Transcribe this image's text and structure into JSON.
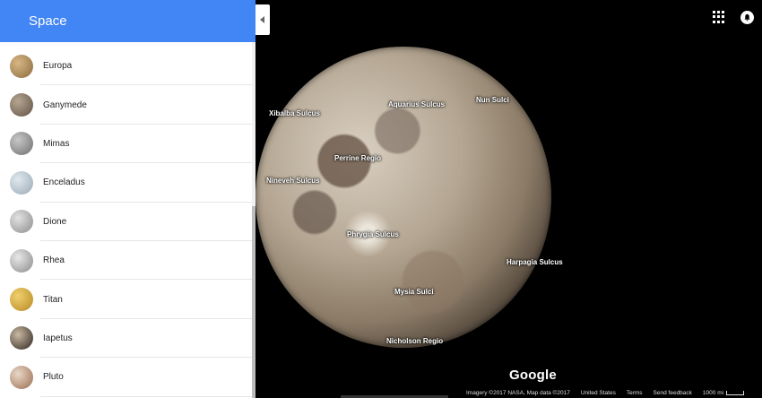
{
  "sidebar": {
    "title": "Space",
    "items": [
      {
        "label": "Europa",
        "color_a": "#d8b684",
        "color_b": "#8a6a3f"
      },
      {
        "label": "Ganymede",
        "color_a": "#b6a592",
        "color_b": "#5f5143"
      },
      {
        "label": "Mimas",
        "color_a": "#c7c7c7",
        "color_b": "#6e6e6e"
      },
      {
        "label": "Enceladus",
        "color_a": "#dfe8ee",
        "color_b": "#9aa9b5"
      },
      {
        "label": "Dione",
        "color_a": "#e2e2e2",
        "color_b": "#8c8c8c"
      },
      {
        "label": "Rhea",
        "color_a": "#e8e8e8",
        "color_b": "#8a8a8a"
      },
      {
        "label": "Titan",
        "color_a": "#f0cf6e",
        "color_b": "#b78a24"
      },
      {
        "label": "Iapetus",
        "color_a": "#c9b9a3",
        "color_b": "#2c241d"
      },
      {
        "label": "Pluto",
        "color_a": "#e9d8c8",
        "color_b": "#9b6b4f"
      }
    ]
  },
  "map": {
    "labels": [
      "Xibalba Sulcus",
      "Aquarius Sulcus",
      "Nun Sulci",
      "Perrine Regio",
      "Nineveh Sulcus",
      "Phrygia Sulcus",
      "Harpagia Sulcus",
      "Mysia Sulci",
      "Nicholson Regio"
    ]
  },
  "footer": {
    "logo": "Google",
    "imagery": "Imagery ©2017 NASA, Map data ©2017",
    "region": "United States",
    "terms": "Terms",
    "feedback": "Send feedback",
    "scale": "1000 mi"
  },
  "colors": {
    "header_blue": "#4285f4"
  }
}
